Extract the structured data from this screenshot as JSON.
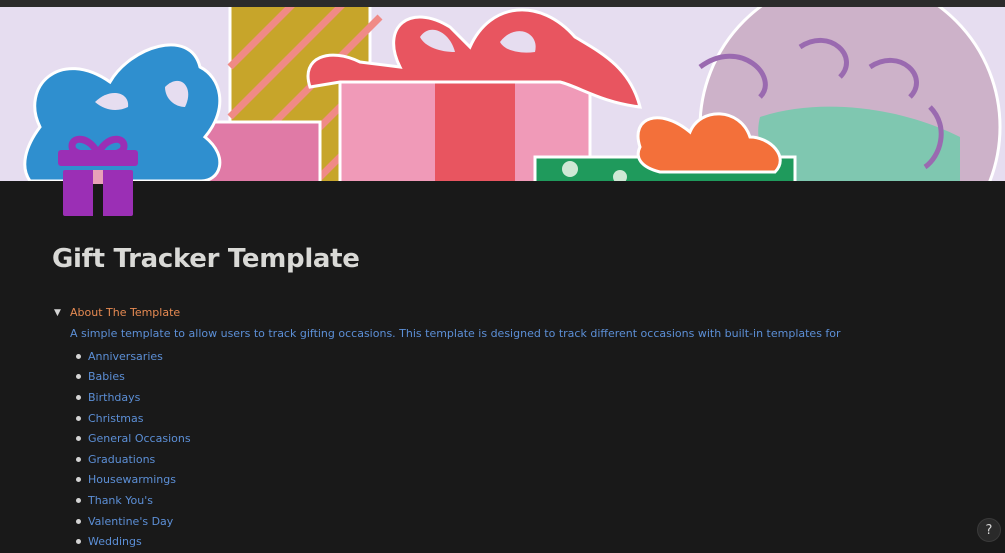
{
  "page": {
    "title": "Gift Tracker Template",
    "icon": "gift-icon",
    "cover": "gift-boxes-illustration"
  },
  "toggle": {
    "label": "About The Template",
    "expanded": true,
    "arrow_icon": "triangle-down-icon"
  },
  "description": "A simple template to allow users to track gifting occasions. This template is designed to track different occasions with built-in templates for",
  "occasions": [
    "Anniversaries",
    "Babies",
    "Birthdays",
    "Christmas",
    "General Occasions",
    "Graduations",
    "Housewarmings",
    "Thank You's",
    "Valentine's Day",
    "Weddings"
  ],
  "help": {
    "label": "?"
  },
  "colors": {
    "background": "#191919",
    "title": "#d9d9d6",
    "toggle_label": "#e68a52",
    "link_blue": "#5c8fd6",
    "icon_purple": "#9b2fb5"
  }
}
